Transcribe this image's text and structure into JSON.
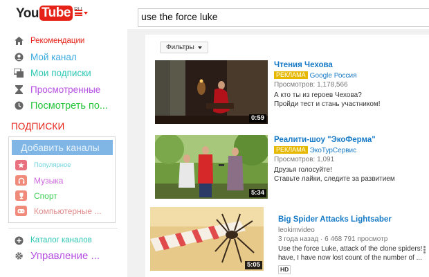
{
  "header": {
    "logo_you": "You",
    "logo_tube": "Tube",
    "logo_region": "RU",
    "search_value": "use the force luke"
  },
  "sidebar": {
    "items": [
      {
        "label": "Рекомендации",
        "icon": "home-icon",
        "color": "#e62117"
      },
      {
        "label": "Мой канал",
        "icon": "person-icon",
        "color": "#36a9e0"
      },
      {
        "label": "Мои подписки",
        "icon": "subscriptions-icon",
        "color": "#2cc6b3"
      },
      {
        "label": "Просмотренные",
        "icon": "hourglass-icon",
        "color": "#b64fe2"
      },
      {
        "label": "Посмотреть по...",
        "icon": "clock-icon",
        "color": "#26c43b"
      }
    ],
    "subscriptions_title": "ПОДПИСКИ",
    "add_channel_label": "Добавить каналы",
    "subscriptions": [
      {
        "label": "Популярное",
        "icon": "star-icon",
        "color": "#6fd4dd",
        "icon_color": "#e9707e"
      },
      {
        "label": "Музыка",
        "icon": "headphones-icon",
        "color": "#cc66dd",
        "icon_color": "#f08a7a"
      },
      {
        "label": "Спорт",
        "icon": "trophy-icon",
        "color": "#3fcf57",
        "icon_color": "#f08a7a"
      },
      {
        "label": "Компьютерные ...",
        "icon": "gamepad-icon",
        "color": "#e08a8a",
        "icon_color": "#f08a7a"
      }
    ],
    "bottom": [
      {
        "label": "Каталог каналов",
        "icon": "plus-circle-icon",
        "color": "#2cc6b3"
      },
      {
        "label": "Управление ...",
        "icon": "gear-icon",
        "color": "#b64fe2"
      }
    ]
  },
  "main": {
    "filters_label": "Фильтры",
    "results": [
      {
        "title": "Чтения Чехова",
        "ad_label": "РЕКЛАМА",
        "channel": "Google Россия",
        "stats": "Просмотров: 1,178,566",
        "desc_lines": [
          "А кто ты из героев Чехова?",
          "Пройди тест и стань участником!"
        ],
        "duration": "0:59",
        "hd": ""
      },
      {
        "title": "Реалити-шоу \"ЭкоФерма\"",
        "ad_label": "РЕКЛАМА",
        "channel": "ЭкоТурСервис",
        "stats": "Просмотров: 1,091",
        "desc_lines": [
          "Друзья голосуйте!",
          "Ставьте лайки, следите за развитием"
        ],
        "duration": "5:34",
        "hd": ""
      },
      {
        "title": "Big Spider Attacks Lightsaber",
        "ad_label": "",
        "channel": "leokimvideo",
        "stats": "3 года назад  ·  6 468 791 просмотр",
        "desc_lines": [
          "Use the force Luke, attack of the clone spiders! Hey",
          "have, I have now lost count of the number of ..."
        ],
        "duration": "5:05",
        "hd": "HD"
      }
    ]
  }
}
